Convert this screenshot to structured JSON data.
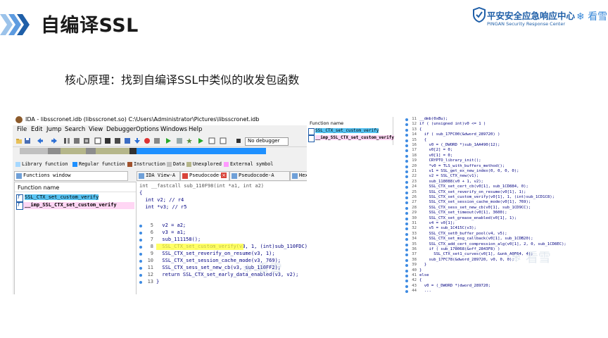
{
  "slide": {
    "title": "自编译SSL",
    "subtitle": "核心原理：找到自编译SSL中类似的收发包函数",
    "logo": {
      "name_cn": "平安安全应急响应中心",
      "name_en": "PINGAN Security Response Center",
      "partner": "看雪"
    },
    "watermark": "看雪"
  },
  "ida": {
    "window_title": "IDA - libsscronet.idb (libsscronet.so) C:\\Users\\Administrator\\Pictures\\libsscronet.idb",
    "menu": [
      "File",
      "Edit",
      "Jump",
      "Search",
      "View",
      "Debugger",
      "Options",
      "Windows",
      "Help"
    ],
    "debugger_select": "No debugger",
    "legend": [
      {
        "label": "Library function",
        "color": "#a6d8ff"
      },
      {
        "label": "Regular function",
        "color": "#1e90ff"
      },
      {
        "label": "Instruction",
        "color": "#a0522d"
      },
      {
        "label": "Data",
        "color": "#c0c0c0"
      },
      {
        "label": "Unexplored",
        "color": "#b5b68a"
      },
      {
        "label": "External symbol",
        "color": "#ff99ff"
      }
    ],
    "functions_window": {
      "tab": "Functions window",
      "header": "Function name",
      "items": [
        "SSL_CTX_set_custom_verify",
        "__imp_SSL_CTX_set_custom_verify"
      ]
    },
    "tabs": [
      "IDA View-A",
      "Pseudocode-B",
      "Pseudocode-A",
      "Hex"
    ],
    "code": [
      {
        "n": "",
        "text": "int __fastcall sub_110F98(int *a1, int a2)"
      },
      {
        "n": "",
        "text": "{"
      },
      {
        "n": "",
        "text": "  int v2; // r4"
      },
      {
        "n": "",
        "text": "  int *v3; // r5"
      },
      {
        "n": "",
        "text": ""
      },
      {
        "n": "5",
        "text": "  v2 = a2;"
      },
      {
        "n": "6",
        "text": "  v3 = a1;"
      },
      {
        "n": "7",
        "text": "  sub_111158();"
      },
      {
        "n": "8",
        "text": "  SSL_CTX_set_custom_verify(v3, 1, (int)sub_110FDC);"
      },
      {
        "n": "9",
        "text": "  SSL_CTX_set_reverify_on_resume(v3, 1);"
      },
      {
        "n": "10",
        "text": "  SSL_CTX_set_session_cache_mode(v3, 769);"
      },
      {
        "n": "11",
        "text": "  SSL_CTX_sess_set_new_cb(v3, sub_110FF2);"
      },
      {
        "n": "12",
        "text": "  return SSL_CTX_set_early_data_enabled(v3, v2);"
      },
      {
        "n": "13",
        "text": "}"
      }
    ]
  },
  "right": {
    "functions_header": "Function name",
    "functions": [
      "SSL_CTX_set_custom_verify",
      "__imp_SSL_CTX_set_custom_verify"
    ],
    "code": [
      {
        "n": "11",
        "text": "__dmb(0xBu);"
      },
      {
        "n": "12",
        "text": "if ( (unsigned int)v0 <= 1 )"
      },
      {
        "n": "13",
        "text": "{"
      },
      {
        "n": "14",
        "text": "  if ( sub_17FC00(&dword_289720) )"
      },
      {
        "n": "15",
        "text": "  {"
      },
      {
        "n": "16",
        "text": "    v0 = (_DWORD *)sub_1AA490(12);"
      },
      {
        "n": "17",
        "text": "    v0[2] = 0;"
      },
      {
        "n": "18",
        "text": "    v0[1] = 0;"
      },
      {
        "n": "19",
        "text": "    CRYPTO_library_init();"
      },
      {
        "n": "20",
        "text": "    *v0 = TLS_with_buffers_method();"
      },
      {
        "n": "21",
        "text": "    v1 = SSL_get_ex_new_index(0, 0, 0, 0);"
      },
      {
        "n": "22",
        "text": "    v2 = SSL_CTX_new(v1);"
      },
      {
        "n": "23",
        "text": "    sub_118088(v0 + 1, v2);"
      },
      {
        "n": "24",
        "text": "    SSL_CTX_set_cert_cb(v0[1], sub_1CD884, 0);"
      },
      {
        "n": "25",
        "text": "    SSL_CTX_set_reverify_on_resume(v0[1], 1);"
      },
      {
        "n": "26",
        "text": "    SSL_CTX_set_custom_verify(v0[1], 1, (int)sub_1CD1C8);"
      },
      {
        "n": "27",
        "text": "    SSL_CTX_set_session_cache_mode(v0[1], 769);"
      },
      {
        "n": "28",
        "text": "    SSL_CTX_sess_set_new_cb(v0[1], sub_1CD9CC);"
      },
      {
        "n": "29",
        "text": "    SSL_CTX_set_timeout(v0[1], 3600);"
      },
      {
        "n": "30",
        "text": "    SSL_CTX_set_grease_enabled(v0[1], 1);"
      },
      {
        "n": "31",
        "text": "    v4 = v0[1];"
      },
      {
        "n": "32",
        "text": "    v5 = sub_1C415C(v3);"
      },
      {
        "n": "33",
        "text": "    SSL_CTX_set0_buffer_pool(v4, v5);"
      },
      {
        "n": "34",
        "text": "    SSL_CTX_set_msg_callback(v0[1], sub_1CDB20);"
      },
      {
        "n": "35",
        "text": "    SSL_CTX_add_cert_compression_alg(v0[1], 2, 0, sub_1CD8EC);"
      },
      {
        "n": "36",
        "text": "    if ( sub_178068(&off_2843F8) )"
      },
      {
        "n": "37",
        "text": "      SSL_CTX_set1_curves(v0[1], &unk_A0F64, 4);"
      },
      {
        "n": "38",
        "text": "    sub_17FC78(&dword_289720, v0, 0, 0);"
      },
      {
        "n": "39",
        "text": "  }"
      },
      {
        "n": "40",
        "text": "}"
      },
      {
        "n": "41",
        "text": "else"
      },
      {
        "n": "42",
        "text": "{"
      },
      {
        "n": "43",
        "text": "  v0 = (_DWORD *)dword_289720;"
      },
      {
        "n": "44",
        "text": "  ..."
      }
    ]
  }
}
